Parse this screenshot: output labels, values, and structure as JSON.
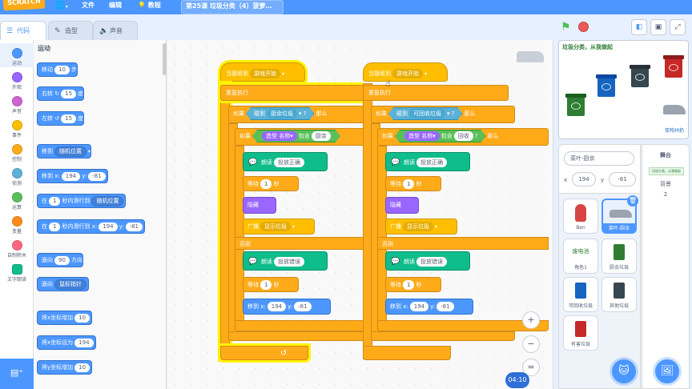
{
  "menubar": {
    "logo": "SCRATCH",
    "globe_icon": "globe-icon",
    "file": "文件",
    "edit": "编辑",
    "tutorials": "教程",
    "project_title": "第25课 垃圾分类（4）菠萝…"
  },
  "tabs": [
    {
      "label": "代码",
      "icon": "code-icon"
    },
    {
      "label": "造型",
      "icon": "brush-icon"
    },
    {
      "label": "声音",
      "icon": "speaker-icon"
    }
  ],
  "categories": [
    {
      "label": "运动",
      "color": "#4c97ff"
    },
    {
      "label": "外观",
      "color": "#9966ff"
    },
    {
      "label": "声音",
      "color": "#cf63cf"
    },
    {
      "label": "事件",
      "color": "#ffbf00"
    },
    {
      "label": "控制",
      "color": "#ffab19"
    },
    {
      "label": "侦测",
      "color": "#5cb1d6"
    },
    {
      "label": "运算",
      "color": "#59c059"
    },
    {
      "label": "变量",
      "color": "#ff8c1a"
    },
    {
      "label": "自制积木",
      "color": "#ff6680"
    },
    {
      "label": "文字朗读",
      "color": "#0fbd8c"
    }
  ],
  "palette": {
    "heading": "运动",
    "move": {
      "a": "移动",
      "v": "10",
      "b": "步"
    },
    "turn_right": {
      "a": "右转",
      "v": "15",
      "b": "度"
    },
    "turn_left": {
      "a": "左转",
      "v": "15",
      "b": "度"
    },
    "goto": {
      "a": "移到",
      "dd": "随机位置"
    },
    "goto_xy": {
      "a": "移到 x:",
      "x": "194",
      "y_label": "y:",
      "y": "-81"
    },
    "glide_random": {
      "a": "在",
      "v": "1",
      "b": "秒内滑行到",
      "dd": "随机位置"
    },
    "glide_xy": {
      "a": "在",
      "v": "1",
      "b": "秒内滑行到 x:",
      "x": "194",
      "y_label": "y:",
      "y": "-81"
    },
    "point_dir": {
      "a": "面向",
      "v": "90",
      "b": "方向"
    },
    "point_towards": {
      "a": "面向",
      "dd": "鼠标指针"
    },
    "change_x": {
      "a": "将x坐标增加",
      "v": "10"
    },
    "set_x": {
      "a": "将x坐标设为",
      "v": "194"
    },
    "change_y": {
      "a": "将y坐标增加",
      "v": "10"
    }
  },
  "script1": {
    "hat": "当接收到",
    "hat_dd": "游戏开始",
    "forever": "重复执行",
    "if1_a": "如果",
    "touch": "碰到",
    "touch_dd": "厨余垃圾",
    "then": "那么",
    "if2_a": "如果",
    "costume": "造型",
    "name_dd": "名称",
    "contains": "包含",
    "contains_val": "厨余",
    "speak1_a": "朗读",
    "speak1_v": "投放正确",
    "wait1_a": "等待",
    "wait1_v": "1",
    "wait1_b": "秒",
    "hide": "隐藏",
    "broadcast_a": "广播",
    "broadcast_dd": "显示垃圾",
    "else": "否则",
    "speak2_a": "朗读",
    "speak2_v": "投放错误",
    "wait2_a": "等待",
    "wait2_v": "1",
    "wait2_b": "秒",
    "goto_a": "移到 x:",
    "goto_x": "194",
    "goto_y_label": "y:",
    "goto_y": "-81"
  },
  "script2": {
    "hat": "当接收到",
    "hat_dd": "游戏开始",
    "forever": "重复执行",
    "if1_a": "如果",
    "touch": "碰到",
    "touch_dd": "可回收垃圾",
    "q": "?",
    "then": "那么",
    "if2_a": "如果",
    "costume": "造型",
    "name_dd": "名称",
    "contains": "包含",
    "contains_val": "回收",
    "q2": "?",
    "then2": "那么",
    "speak1_a": "朗读",
    "speak1_v": "投放正确",
    "wait1_a": "等待",
    "wait1_v": "1",
    "wait1_b": "秒",
    "hide": "隐藏",
    "broadcast_a": "广播",
    "broadcast_dd": "显示垃圾",
    "else": "否则",
    "speak2_a": "朗读",
    "speak2_v": "投放错误",
    "wait2_a": "等待",
    "wait2_v": "1",
    "wait2_b": "秒",
    "goto_a": "移到 x:",
    "goto_x": "194",
    "goto_y_label": "y:",
    "goto_y": "-81"
  },
  "zoom": {
    "in": "+",
    "out": "−",
    "reset": "="
  },
  "timer": "04:10",
  "stage": {
    "title": "垃圾分类，从我做起",
    "shoe_label": "炭吨州扔"
  },
  "sprite_info": {
    "name": "菜叶-厨余",
    "x_label": "x",
    "x": "194",
    "y_label": "y",
    "y": "-81"
  },
  "sprites": [
    {
      "label": "Ben"
    },
    {
      "label": "菜叶-厨余"
    },
    {
      "label": "角色1",
      "text": "废电池"
    },
    {
      "label": "厨余垃圾"
    },
    {
      "label": "可回收垃圾"
    },
    {
      "label": "其他垃圾"
    },
    {
      "label": "有害垃圾"
    }
  ],
  "stage_panel": {
    "title": "舞台",
    "bg_label": "背景",
    "bg_count": "2",
    "thumb_text": "垃圾分类，从我做起"
  }
}
